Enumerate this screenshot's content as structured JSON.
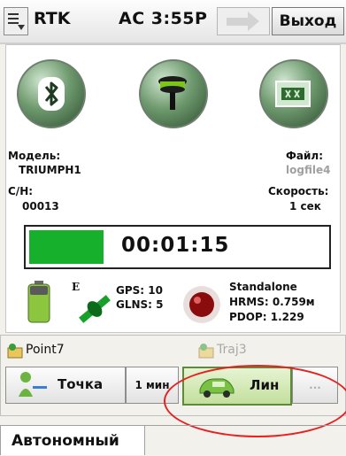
{
  "header": {
    "app_title": "RTK",
    "status_time": "AC  3:55P",
    "exit_label": "Выход"
  },
  "device": {
    "model_label": "Модель:",
    "model_value": "TRIUMPH1",
    "serial_label": "С/Н:",
    "serial_value": "00013",
    "file_label": "Файл:",
    "file_value": "logfile4",
    "rate_label": "Скорость:",
    "rate_value": "1 сек"
  },
  "recording": {
    "elapsed": "00:01:15",
    "progress_fraction": 0.25
  },
  "gnss": {
    "engine_mark": "E",
    "gps": "GPS: 10",
    "glns": "GLNS: 5",
    "solution": "Standalone",
    "hrms": "HRMS: 0.759м",
    "pdop": "PDOP: 1.229"
  },
  "collection": {
    "point_name": "Point7",
    "traj_name": "Traj3",
    "point_button": "Точка",
    "interval_button": "1 мин",
    "line_button": "Лин",
    "more_button": "..."
  },
  "tabs": {
    "active": "Автономный"
  },
  "colors": {
    "progress": "#17b02c",
    "highlight": "#e52222"
  }
}
